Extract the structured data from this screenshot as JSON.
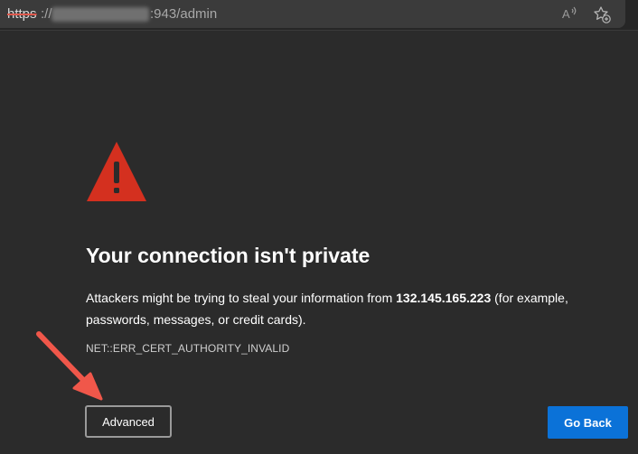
{
  "browser": {
    "url_scheme": "https",
    "url_separator": "://",
    "url_path": ":943/admin",
    "icons": {
      "read_aloud": "read-aloud-icon",
      "favorite": "add-favorite-icon"
    }
  },
  "error_page": {
    "warning_icon": "warning-triangle-icon",
    "title": "Your connection isn't private",
    "description_prefix": "Attackers might be trying to steal your information from ",
    "host": "132.145.165.223",
    "description_suffix": " (for example, passwords, messages, or credit cards).",
    "error_code": "NET::ERR_CERT_AUTHORITY_INVALID",
    "advanced_label": "Advanced",
    "go_back_label": "Go Back"
  },
  "colors": {
    "background": "#2b2b2b",
    "warning_red": "#d4301f",
    "primary_blue": "#0b72d8",
    "annotation_arrow": "#f0574a"
  }
}
